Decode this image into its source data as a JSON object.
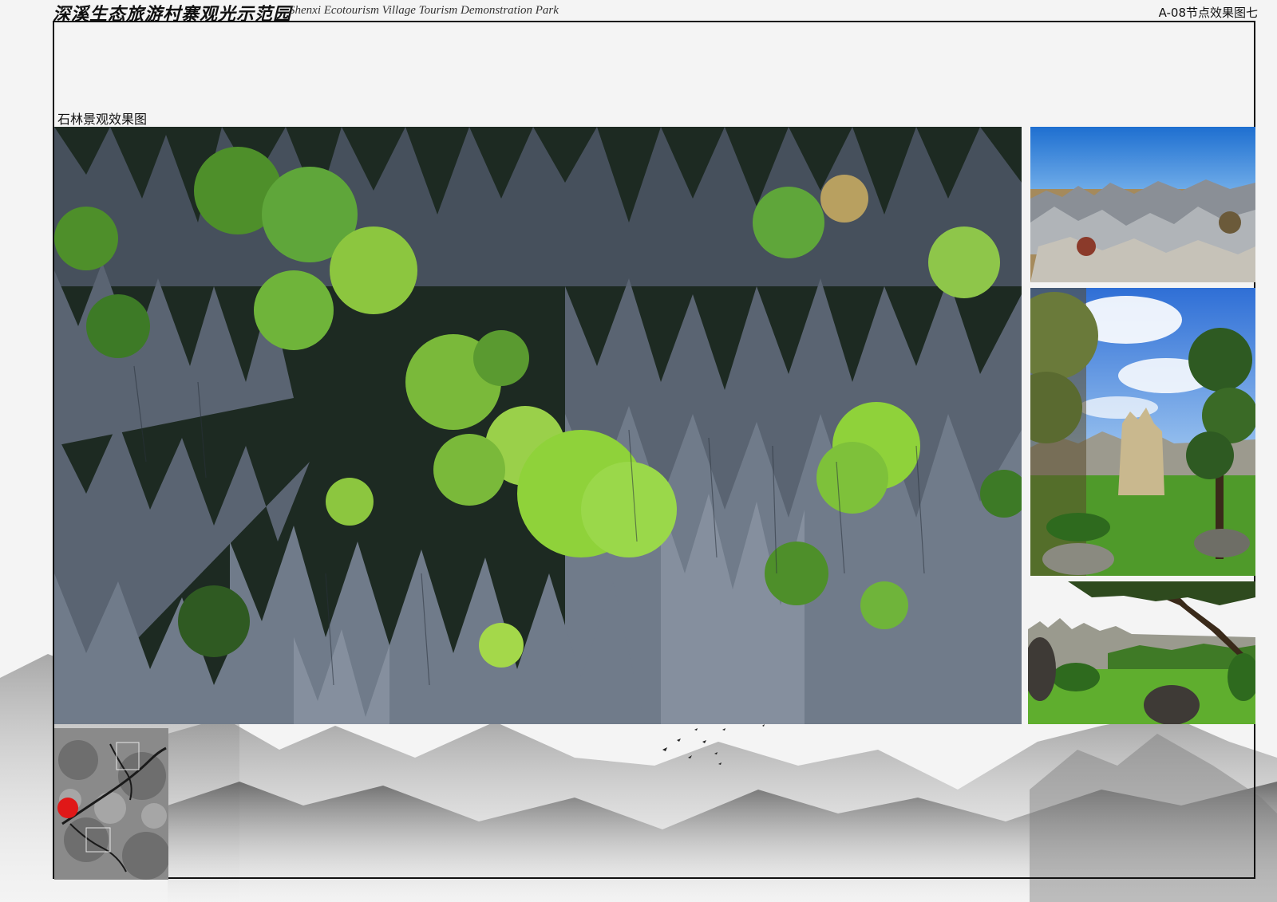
{
  "header": {
    "title_cn": "深溪生态旅游村寨观光示范园",
    "title_en": "Shenxi Ecotourism Village Tourism Demonstration Park",
    "sheet_code": "A-08节点效果图七"
  },
  "section": {
    "label": "石林景观效果图"
  },
  "images": {
    "main": "stone-forest-aerial-photo",
    "side_1": "stone-forest-blue-sky-photo",
    "side_2": "stone-pillar-with-trees-photo",
    "side_3": "stone-forest-lawn-photo",
    "locator": "site-location-map"
  },
  "colors": {
    "frame": "#111111",
    "marker": "#e01818",
    "rock": "#3c4450",
    "foliage": "#7dc23a",
    "sky": "#2f7fd6",
    "grass": "#4f9a2a"
  }
}
